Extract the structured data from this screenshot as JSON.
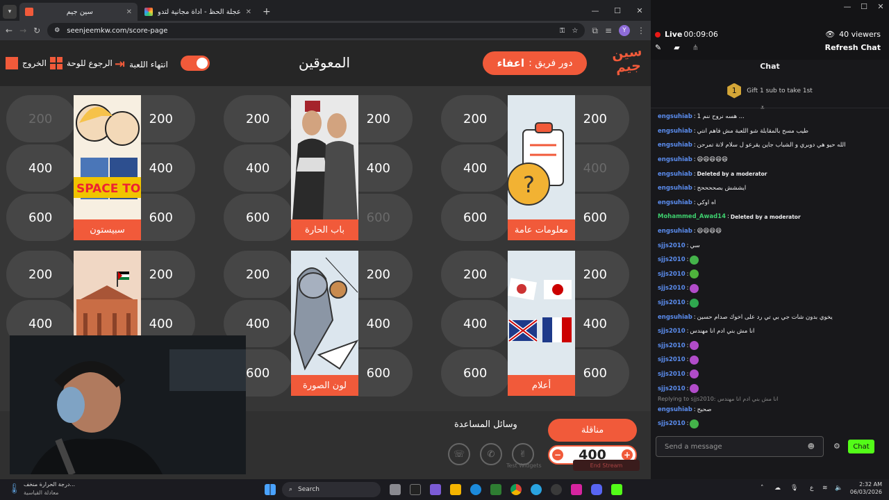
{
  "browser": {
    "tabs": [
      {
        "label": "سين جيم",
        "active": true
      },
      {
        "label": "عجلة الحظ - أداة مجانية لتدوير الا",
        "active": false
      }
    ],
    "url": "seenjeemkw.com/score-page"
  },
  "game": {
    "logo": "سين جيم",
    "turn_prefix": "دور فريق :",
    "turn_team": "اعفاء",
    "title": "المعوقين",
    "end_game": "انتهاء اللعبة",
    "back_to_board": "الرجوع للوحة",
    "exit": "الخروج",
    "categories": [
      {
        "name": "معلومات عامة",
        "left": [
          "200",
          "400",
          "600"
        ],
        "right": [
          "200",
          "400",
          "600"
        ],
        "used_left": [
          false,
          false,
          false
        ],
        "used_right": [
          false,
          true,
          false
        ]
      },
      {
        "name": "باب الحارة",
        "left": [
          "200",
          "400",
          "600"
        ],
        "right": [
          "200",
          "400",
          "600"
        ],
        "used_left": [
          false,
          false,
          false
        ],
        "used_right": [
          false,
          false,
          true
        ]
      },
      {
        "name": "سبيستون",
        "left": [
          "200",
          "400",
          "600"
        ],
        "right": [
          "200",
          "400",
          "600"
        ],
        "used_left": [
          true,
          false,
          false
        ],
        "used_right": [
          false,
          false,
          false
        ]
      },
      {
        "name": "أعلام",
        "left": [
          "200",
          "400",
          "600"
        ],
        "right": [
          "200",
          "400",
          "600"
        ],
        "used_left": [
          false,
          false,
          false
        ],
        "used_right": [
          false,
          false,
          false
        ]
      },
      {
        "name": "لون الصورة",
        "left": [
          "200",
          "400",
          "600"
        ],
        "right": [
          "200",
          "400",
          "600"
        ],
        "used_left": [
          false,
          false,
          false
        ],
        "used_right": [
          false,
          false,
          false
        ]
      },
      {
        "name": "",
        "left": [
          "200",
          "400"
        ],
        "right": [
          "200",
          "400"
        ],
        "used_left": [
          false,
          false
        ],
        "used_right": [
          false,
          false
        ]
      }
    ],
    "aids_label": "وسائل المساعدة",
    "team_name": "مناقلة",
    "score": "400",
    "minus": "−",
    "plus": "+",
    "space_toon_text": "SPACE TOON"
  },
  "stream": {
    "live_label": "Live",
    "live_time": "00:09:06",
    "viewers": "40 viewers",
    "refresh_chat": "Refresh Chat",
    "chat_title": "Chat",
    "gift_text": "Gift 1 sub to take 1st",
    "gift_rank": "1",
    "messages": [
      {
        "user": "engsuhiab",
        "text": "هسه نروح ننم 1 ...",
        "color": "#5b8def"
      },
      {
        "user": "engsuhiab",
        "text": "طيب مسح بالمقابلة شو اللعبة مش فاهم انتي",
        "color": "#5b8def"
      },
      {
        "user": "engsuhiab",
        "text": "الله حيو هي دوبري و الشباب جاين يقرعو ل سلام لانة تمرحن",
        "color": "#5b8def"
      },
      {
        "user": "engsuhiab",
        "text": "😆😆😆😆😆",
        "color": "#5b8def"
      },
      {
        "user": "engsuhiab",
        "text": "Deleted by a moderator",
        "color": "#5b8def"
      },
      {
        "user": "engsuhiab",
        "text": "ايششش بصححححح",
        "color": "#5b8def"
      },
      {
        "user": "engsuhiab",
        "text": "اه اوكي",
        "color": "#5b8def"
      },
      {
        "user": "Mohammed_Awad14",
        "text": "Deleted by a moderator",
        "color": "#3ecf6e"
      },
      {
        "user": "engsuhiab",
        "text": "😆😆😆😆",
        "color": "#5b8def"
      },
      {
        "user": "sjjs2010",
        "text": "سي",
        "color": "#5b8def"
      },
      {
        "user": "sjjs2010",
        "text": "",
        "color": "#5b8def",
        "emote": "#44b34a"
      },
      {
        "user": "sjjs2010",
        "text": "",
        "color": "#5b8def",
        "emote": "#4fb33c"
      },
      {
        "user": "sjjs2010",
        "text": "",
        "color": "#5b8def",
        "emote": "#b14cc9"
      },
      {
        "user": "sjjs2010",
        "text": "",
        "color": "#5b8def",
        "emote": "#2fa84f"
      },
      {
        "user": "engsuhiab",
        "text": "يخوي بدون شات جي بي تي رد على اخوك صدام حسين",
        "color": "#5b8def"
      },
      {
        "user": "sjjs2010",
        "text": "انا مش بني ادم انا مهندس",
        "color": "#5b8def"
      },
      {
        "user": "sjjs2010",
        "text": "",
        "color": "#5b8def",
        "emote": "#b14cc9"
      },
      {
        "user": "sjjs2010",
        "text": "",
        "color": "#5b8def",
        "emote": "#b14cc9"
      },
      {
        "user": "sjjs2010",
        "text": "",
        "color": "#5b8def",
        "emote": "#b14cc9"
      },
      {
        "user": "sjjs2010",
        "text": "",
        "color": "#5b8def",
        "emote": "#b14cc9"
      }
    ],
    "reply_note": "Replying to sjjs2010: انا مش بني ادم انا مهندس",
    "reply_user": "engsuhiab",
    "reply_text": "صحيح",
    "last_user": "sjjs2010",
    "input_placeholder": "Send a message",
    "chat_button": "Chat",
    "test_widgets": "Test Widgets",
    "end_stream": "End Stream"
  },
  "taskbar": {
    "weather_line1": "درجة الحرارة منخف...",
    "weather_line2": "معادلة القياسية",
    "search": "Search",
    "time": "2:32 AM",
    "date": "06/03/2026",
    "lang": "ع"
  },
  "colors": {
    "accent": "#f15a3a",
    "kick_green": "#53fc18"
  }
}
